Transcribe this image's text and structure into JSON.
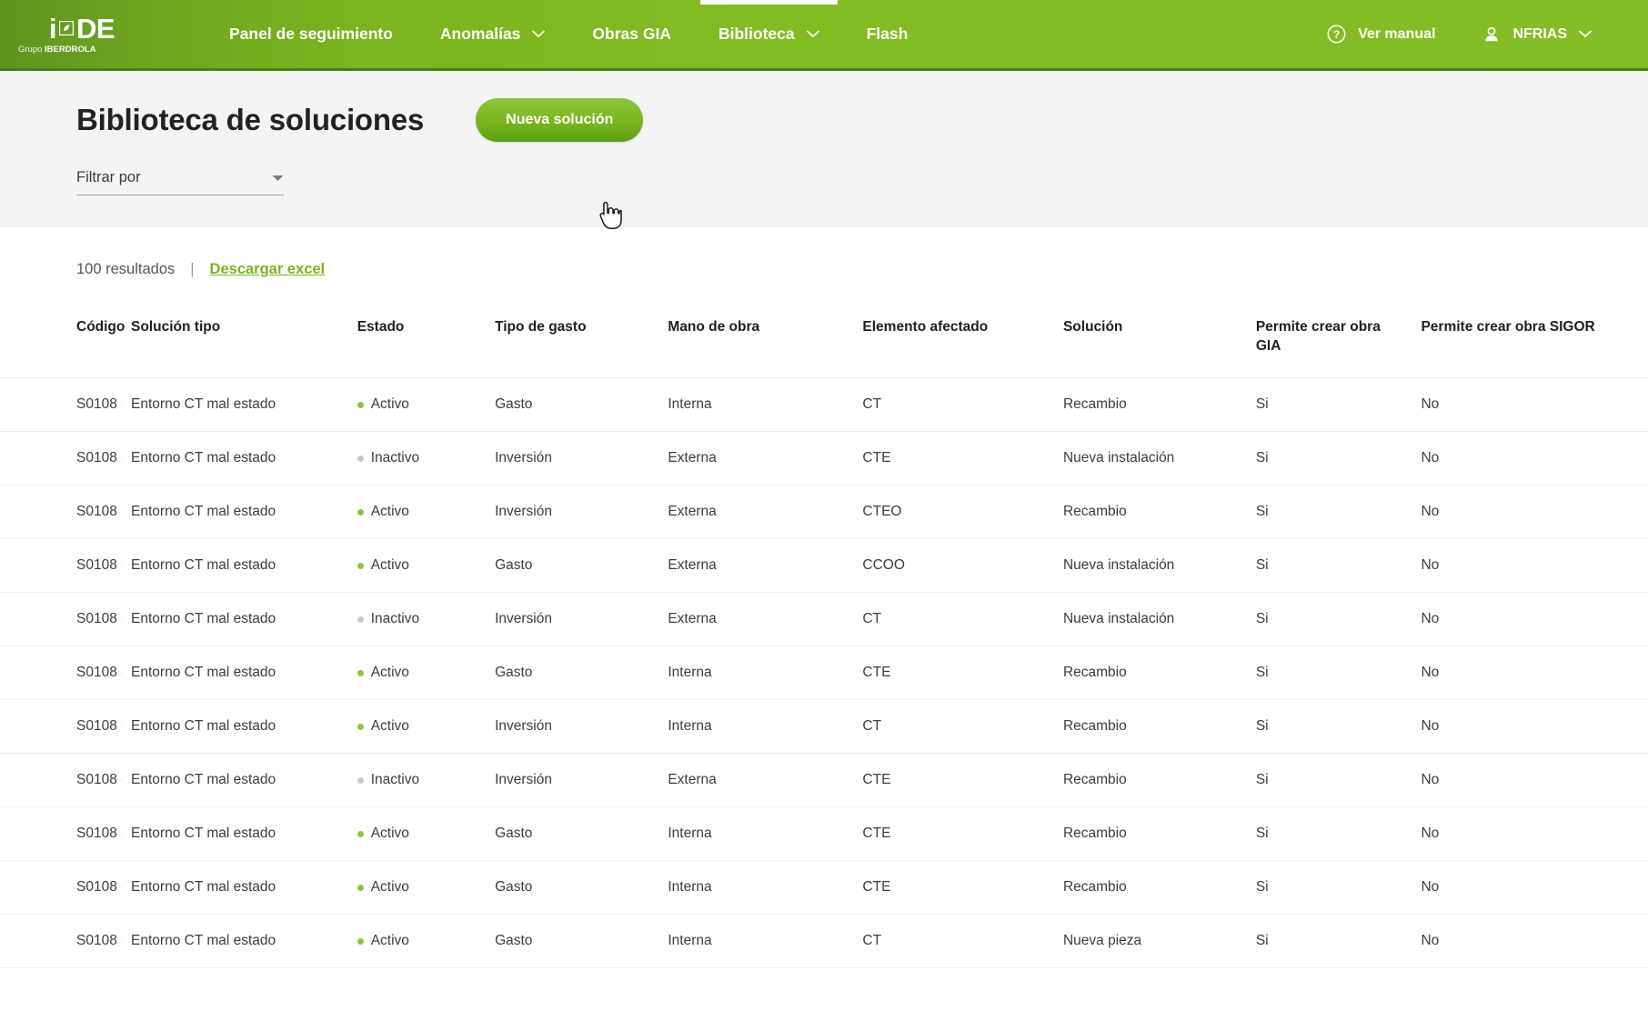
{
  "navbar": {
    "logo": {
      "i": "i",
      "de": "DE",
      "leaf_icon": "leaf-icon",
      "sub_grupo": "Grupo ",
      "sub_brand": "IBERDROLA"
    },
    "items": [
      {
        "label": "Panel de seguimiento",
        "has_caret": false,
        "active": false
      },
      {
        "label": "Anomalías",
        "has_caret": true,
        "active": false
      },
      {
        "label": "Obras GIA",
        "has_caret": false,
        "active": false
      },
      {
        "label": "Biblioteca",
        "has_caret": true,
        "active": true
      },
      {
        "label": "Flash",
        "has_caret": false,
        "active": false
      }
    ],
    "help": {
      "label": "Ver manual",
      "icon": "help-circle-icon"
    },
    "user": {
      "label": "NFRIAS",
      "icon": "person-icon",
      "caret_icon": "chevron-down-icon"
    }
  },
  "page": {
    "title": "Biblioteca de soluciones",
    "new_button": "Nueva solución",
    "filter": {
      "label": "Filtrar por",
      "caret_icon": "dropdown-caret-icon"
    },
    "results_count": "100 resultados",
    "results_separator": "|",
    "download_link": "Descargar excel"
  },
  "colors": {
    "brand_green": "#7ab51d",
    "nav_green_dark": "#5f931f",
    "nav_green_light": "#85bd26",
    "status_active": "#8cc63f",
    "status_inactive": "#c9c9c9",
    "grey_band": "#f4f4f4"
  },
  "table": {
    "columns": [
      "Código",
      "Solución tipo",
      "Estado",
      "Tipo de gasto",
      "Mano de obra",
      "Elemento afectado",
      "Solución",
      "Permite crear obra GIA",
      "Permite crear obra SIGOR"
    ],
    "rows": [
      {
        "codigo": "S0108 -",
        "solucion_tipo": "Entorno CT mal estado",
        "estado": "Activo",
        "tipo_gasto": "Gasto",
        "mano_obra": "Interna",
        "elemento": "CT",
        "solucion": "Recambio",
        "gia": "Si",
        "sigor": "No"
      },
      {
        "codigo": "S0108 -",
        "solucion_tipo": "Entorno CT mal estado",
        "estado": "Inactivo",
        "tipo_gasto": "Inversión",
        "mano_obra": "Externa",
        "elemento": "CTE",
        "solucion": "Nueva instalación",
        "gia": "Si",
        "sigor": "No"
      },
      {
        "codigo": "S0108 -",
        "solucion_tipo": "Entorno CT mal estado",
        "estado": "Activo",
        "tipo_gasto": "Inversión",
        "mano_obra": "Externa",
        "elemento": "CTEO",
        "solucion": "Recambio",
        "gia": "Si",
        "sigor": "No"
      },
      {
        "codigo": "S0108 -",
        "solucion_tipo": "Entorno CT mal estado",
        "estado": "Activo",
        "tipo_gasto": "Gasto",
        "mano_obra": "Externa",
        "elemento": "CCOO",
        "solucion": "Nueva instalación",
        "gia": "Si",
        "sigor": "No"
      },
      {
        "codigo": "S0108 -",
        "solucion_tipo": "Entorno CT mal estado",
        "estado": "Inactivo",
        "tipo_gasto": "Inversión",
        "mano_obra": "Externa",
        "elemento": "CT",
        "solucion": "Nueva instalación",
        "gia": "Si",
        "sigor": "No"
      },
      {
        "codigo": "S0108 -",
        "solucion_tipo": "Entorno CT mal estado",
        "estado": "Activo",
        "tipo_gasto": "Gasto",
        "mano_obra": "Interna",
        "elemento": "CTE",
        "solucion": "Recambio",
        "gia": "Si",
        "sigor": "No"
      },
      {
        "codigo": "S0108 -",
        "solucion_tipo": "Entorno CT mal estado",
        "estado": "Activo",
        "tipo_gasto": "Inversión",
        "mano_obra": "Interna",
        "elemento": "CT",
        "solucion": "Recambio",
        "gia": "Si",
        "sigor": "No"
      },
      {
        "codigo": "S0108 -",
        "solucion_tipo": "Entorno CT mal estado",
        "estado": "Inactivo",
        "tipo_gasto": "Inversión",
        "mano_obra": "Externa",
        "elemento": "CTE",
        "solucion": "Recambio",
        "gia": "Si",
        "sigor": "No"
      },
      {
        "codigo": "S0108 -",
        "solucion_tipo": "Entorno CT mal estado",
        "estado": "Activo",
        "tipo_gasto": "Gasto",
        "mano_obra": "Interna",
        "elemento": "CTE",
        "solucion": "Recambio",
        "gia": "Si",
        "sigor": "No"
      },
      {
        "codigo": "S0108 -",
        "solucion_tipo": "Entorno CT mal estado",
        "estado": "Activo",
        "tipo_gasto": "Gasto",
        "mano_obra": "Interna",
        "elemento": "CTE",
        "solucion": "Recambio",
        "gia": "Si",
        "sigor": "No"
      },
      {
        "codigo": "S0108 -",
        "solucion_tipo": "Entorno CT mal estado",
        "estado": "Activo",
        "tipo_gasto": "Gasto",
        "mano_obra": "Interna",
        "elemento": "CT",
        "solucion": "Nueva pieza",
        "gia": "Si",
        "sigor": "No"
      }
    ]
  }
}
